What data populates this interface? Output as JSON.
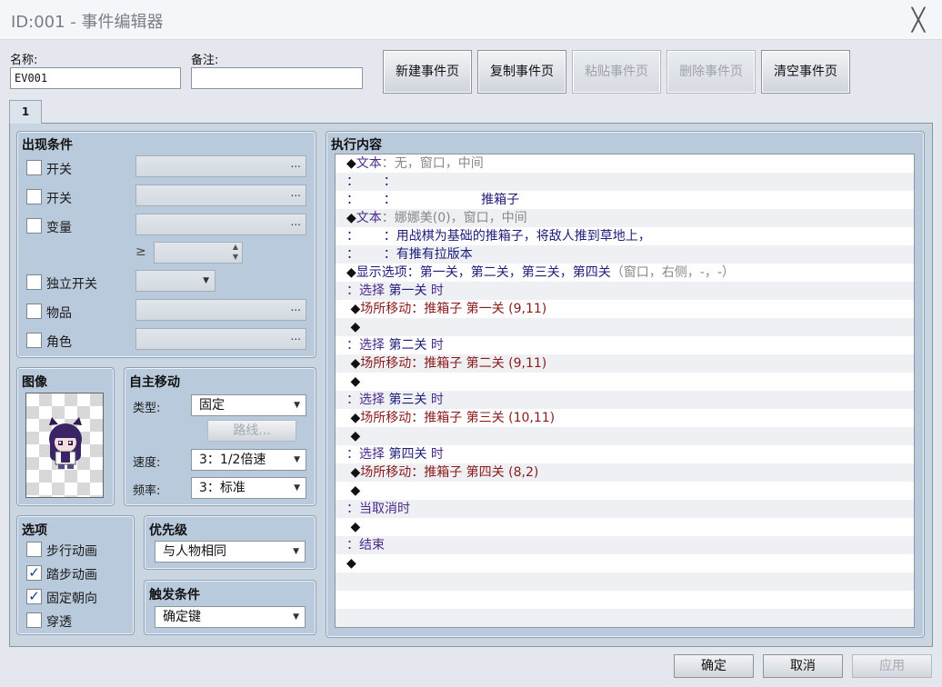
{
  "window": {
    "title": "ID:001 - 事件编辑器",
    "close_glyph": "╳"
  },
  "header": {
    "name_label": "名称:",
    "name_value": "EV001",
    "note_label": "备注:",
    "note_value": ""
  },
  "page_buttons": [
    "新建事件页",
    "复制事件页",
    "粘贴事件页",
    "删除事件页",
    "清空事件页"
  ],
  "page_buttons_disabled": [
    false,
    false,
    true,
    true,
    false
  ],
  "tabs": [
    "1"
  ],
  "conditions": {
    "title": "出现条件",
    "items": [
      "开关",
      "开关",
      "变量",
      "独立开关",
      "物品",
      "角色"
    ],
    "ge_symbol": "≥",
    "dots": "..."
  },
  "image": {
    "title": "图像"
  },
  "autonomous": {
    "title": "自主移动",
    "type_label": "类型:",
    "type_value": "固定",
    "route_button": "路线...",
    "speed_label": "速度:",
    "speed_value": "3：1/2倍速",
    "freq_label": "频率:",
    "freq_value": "3：标准"
  },
  "options": {
    "title": "选项",
    "items": [
      {
        "label": "步行动画",
        "checked": false
      },
      {
        "label": "踏步动画",
        "checked": true
      },
      {
        "label": "固定朝向",
        "checked": true
      },
      {
        "label": "穿透",
        "checked": false
      }
    ],
    "check_glyph": "✓"
  },
  "priority": {
    "title": "优先级",
    "value": "与人物相同"
  },
  "trigger": {
    "title": "触发条件",
    "value": "确定键"
  },
  "contents": {
    "title": "执行内容",
    "rows": [
      [
        {
          "t": "◆",
          "c": "blk"
        },
        {
          "t": "文本",
          "c": "purple"
        },
        {
          "t": "：无，窗口，中间",
          "c": "gray"
        }
      ],
      [
        {
          "t": "：      ：",
          "c": "navy"
        }
      ],
      [
        {
          "t": "：      ：                     推箱子",
          "c": "navy"
        }
      ],
      [
        {
          "t": "◆",
          "c": "blk"
        },
        {
          "t": "文本",
          "c": "purple"
        },
        {
          "t": "：娜娜美(0)，窗口，中间",
          "c": "gray"
        }
      ],
      [
        {
          "t": "：      ：用战棋为基础的推箱子，将敌人推到草地上，",
          "c": "navy"
        }
      ],
      [
        {
          "t": "：      ：有推有拉版本",
          "c": "navy"
        }
      ],
      [
        {
          "t": "◆",
          "c": "blk"
        },
        {
          "t": "显示选项：第一关，第二关，第三关，第四关",
          "c": "navy"
        },
        {
          "t": "（窗口，右侧，-，-）",
          "c": "gray"
        }
      ],
      [
        {
          "t": "：选择 ",
          "c": "purple"
        },
        {
          "t": "第一关",
          "c": "navy"
        },
        {
          "t": " 时",
          "c": "purple"
        }
      ],
      [
        {
          "t": " ◆",
          "c": "blk"
        },
        {
          "t": "场所移动：推箱子 第一关 (9,11)",
          "c": "red"
        }
      ],
      [
        {
          "t": " ◆",
          "c": "blk"
        }
      ],
      [
        {
          "t": "：选择 ",
          "c": "purple"
        },
        {
          "t": "第二关",
          "c": "navy"
        },
        {
          "t": " 时",
          "c": "purple"
        }
      ],
      [
        {
          "t": " ◆",
          "c": "blk"
        },
        {
          "t": "场所移动：推箱子 第二关 (9,11)",
          "c": "red"
        }
      ],
      [
        {
          "t": " ◆",
          "c": "blk"
        }
      ],
      [
        {
          "t": "：选择 ",
          "c": "purple"
        },
        {
          "t": "第三关",
          "c": "navy"
        },
        {
          "t": " 时",
          "c": "purple"
        }
      ],
      [
        {
          "t": " ◆",
          "c": "blk"
        },
        {
          "t": "场所移动：推箱子 第三关 (10,11)",
          "c": "red"
        }
      ],
      [
        {
          "t": " ◆",
          "c": "blk"
        }
      ],
      [
        {
          "t": "：选择 ",
          "c": "purple"
        },
        {
          "t": "第四关",
          "c": "navy"
        },
        {
          "t": " 时",
          "c": "purple"
        }
      ],
      [
        {
          "t": " ◆",
          "c": "blk"
        },
        {
          "t": "场所移动：推箱子 第四关 (8,2)",
          "c": "red"
        }
      ],
      [
        {
          "t": " ◆",
          "c": "blk"
        }
      ],
      [
        {
          "t": "：当取消时",
          "c": "purple"
        }
      ],
      [
        {
          "t": " ◆",
          "c": "blk"
        }
      ],
      [
        {
          "t": "：结束",
          "c": "purple"
        }
      ],
      [
        {
          "t": "◆",
          "c": "blk"
        }
      ],
      [],
      [],
      []
    ]
  },
  "footer": {
    "ok": "确定",
    "cancel": "取消",
    "apply": "应用"
  }
}
